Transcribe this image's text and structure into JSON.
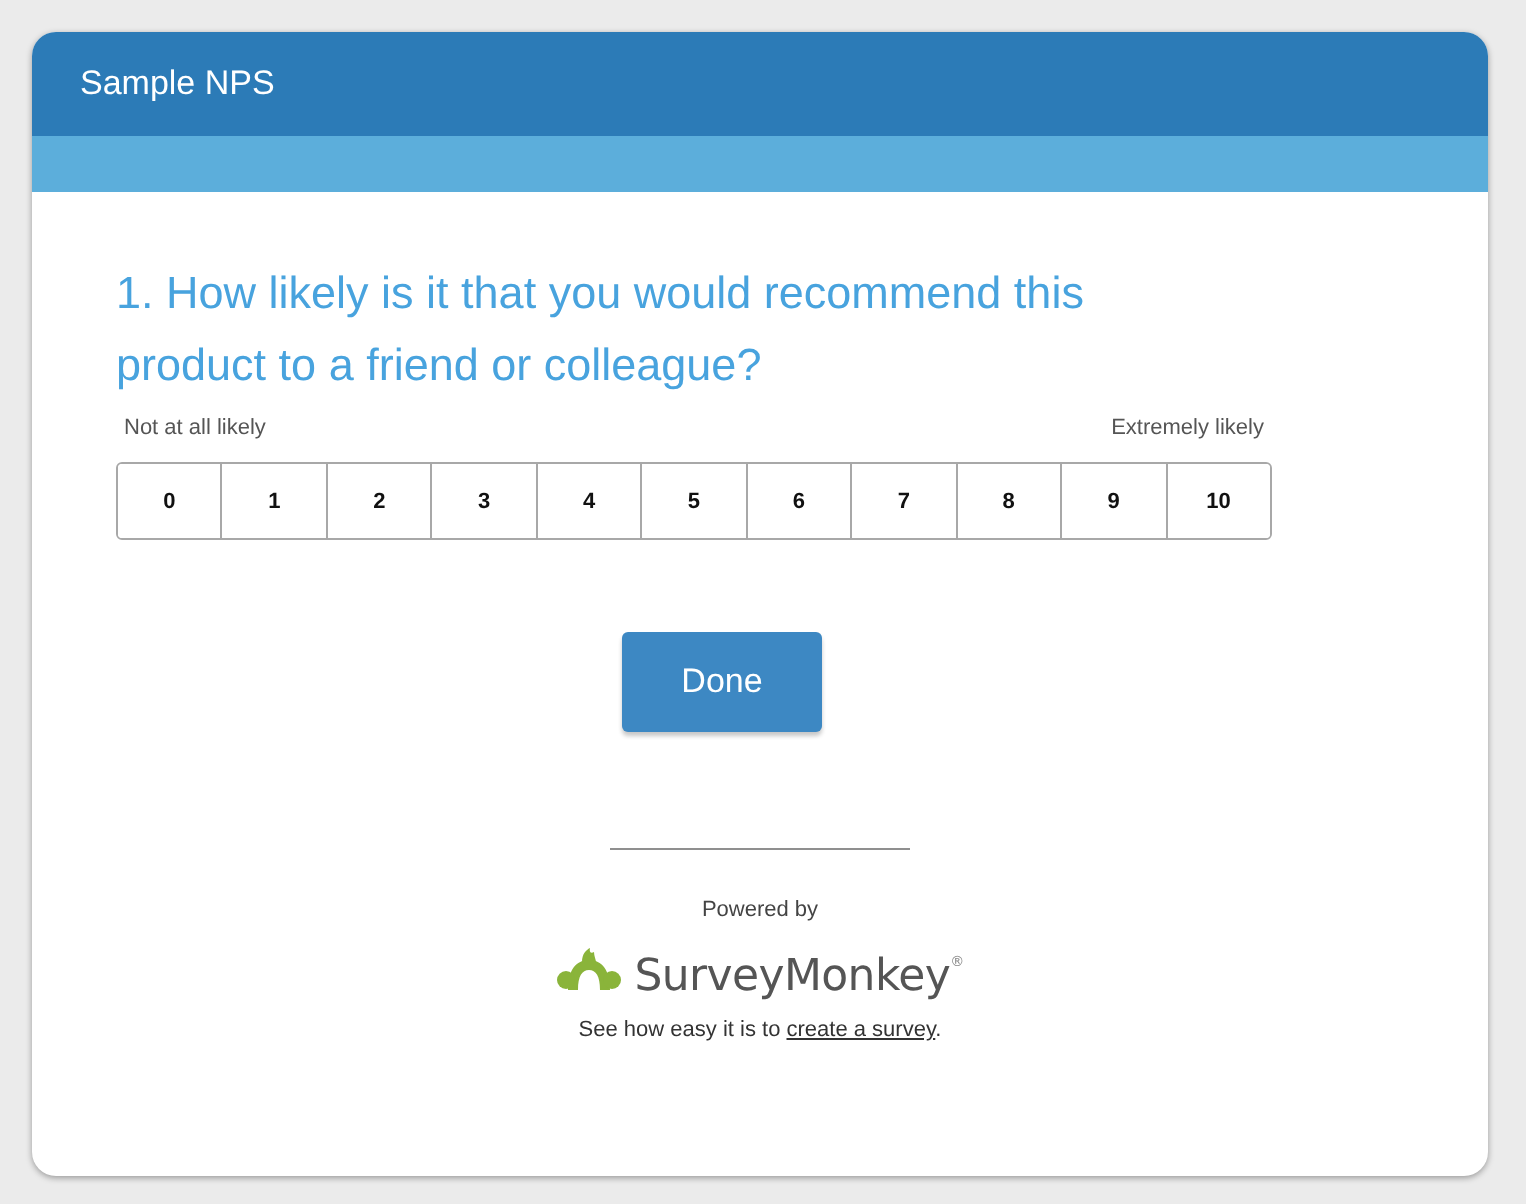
{
  "window": {
    "title": "Sample NPS"
  },
  "question": {
    "text": "1. How likely is it that you would recommend this product to a friend or colleague?"
  },
  "scale": {
    "low_label": "Not at all likely",
    "high_label": "Extremely likely",
    "options": [
      {
        "label": "0",
        "selected": false
      },
      {
        "label": "1",
        "selected": false
      },
      {
        "label": "2",
        "selected": false
      },
      {
        "label": "3",
        "selected": false
      },
      {
        "label": "4",
        "selected": false
      },
      {
        "label": "5",
        "selected": false
      },
      {
        "label": "6",
        "selected": false
      },
      {
        "label": "7",
        "selected": false
      },
      {
        "label": "8",
        "selected": false
      },
      {
        "label": "9",
        "selected": false
      },
      {
        "label": "10",
        "selected": false
      }
    ]
  },
  "done_button": {
    "label": "Done"
  },
  "footer": {
    "powered_by": "Powered by",
    "brand": "SurveyMonkey$^{®}$",
    "note": {
      "text_before": "See how easy it is to ",
      "link": "create a survey",
      "text_after": "."
    }
  }
}
